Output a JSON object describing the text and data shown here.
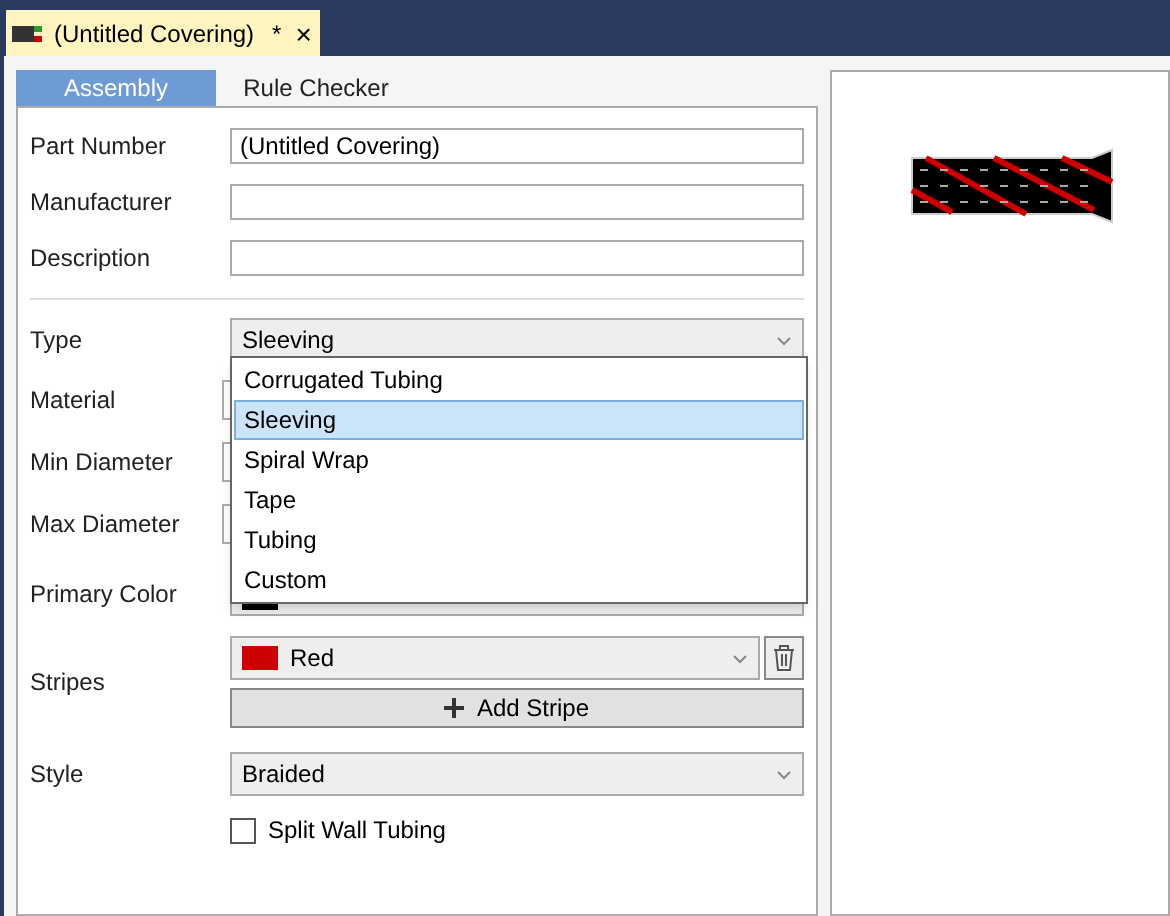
{
  "document_tab": {
    "title": "(Untitled Covering)",
    "modified_mark": "*",
    "close": "×"
  },
  "subtabs": [
    {
      "label": "Assembly",
      "selected": true
    },
    {
      "label": "Rule Checker",
      "selected": false
    }
  ],
  "text_fields": [
    {
      "label": "Part Number",
      "value": "(Untitled Covering)"
    },
    {
      "label": "Manufacturer"
    },
    {
      "label": "Description"
    }
  ],
  "type": {
    "label": "Type",
    "value": "Sleeving",
    "expanded": true,
    "options": [
      {
        "label": "Corrugated Tubing",
        "selected": false
      },
      {
        "label": "Sleeving",
        "selected": true
      },
      {
        "label": "Spiral Wrap",
        "selected": false
      },
      {
        "label": "Tape",
        "selected": false
      },
      {
        "label": "Tubing",
        "selected": false
      },
      {
        "label": "Custom",
        "selected": false
      }
    ]
  },
  "hidden_fields": [
    {
      "label": "Material"
    },
    {
      "label": "Min Diameter"
    },
    {
      "label": "Max Diameter"
    }
  ],
  "primary_color": {
    "label": "Primary Color",
    "color": "#000000"
  },
  "stripes": {
    "label": "Stripes",
    "items": [
      {
        "name": "Red",
        "color": "#cc0000"
      }
    ],
    "add_button": "Add Stripe"
  },
  "style": {
    "label": "Style",
    "value": "Braided"
  },
  "split_wall": {
    "label": "Split Wall Tubing",
    "checked": false
  }
}
